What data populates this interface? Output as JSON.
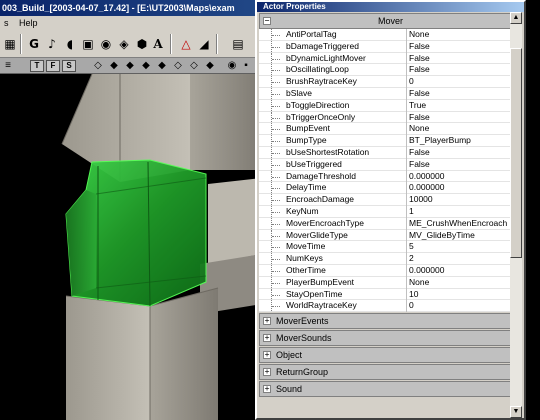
{
  "window": {
    "title": "003_Build_[2003-04-07_17.42] - [E:\\UT2003\\Maps\\exam",
    "menu": [
      "s",
      "Help"
    ]
  },
  "toolbar": {
    "icons": [
      "grid-icon",
      "g-icon",
      "music-note-icon",
      "speaker-icon",
      "mesh-icon",
      "eye-icon",
      "static-mesh-icon",
      "prefab-icon",
      "text-a-icon",
      "actor-triangle-icon",
      "terrain-icon",
      "level-icon"
    ],
    "glyph_g": "G",
    "glyph_a": "A"
  },
  "viewport_toolbar": {
    "buttons": [
      "T",
      "F",
      "S"
    ]
  },
  "properties": {
    "title": "Actor Properties",
    "open_group": "Mover",
    "rows": [
      {
        "name": "AntiPortalTag",
        "value": "None"
      },
      {
        "name": "bDamageTriggered",
        "value": "False"
      },
      {
        "name": "bDynamicLightMover",
        "value": "False"
      },
      {
        "name": "bOscillatingLoop",
        "value": "False"
      },
      {
        "name": "BrushRaytraceKey",
        "value": "0"
      },
      {
        "name": "bSlave",
        "value": "False"
      },
      {
        "name": "bToggleDirection",
        "value": "True"
      },
      {
        "name": "bTriggerOnceOnly",
        "value": "False"
      },
      {
        "name": "BumpEvent",
        "value": "None"
      },
      {
        "name": "BumpType",
        "value": "BT_PlayerBump"
      },
      {
        "name": "bUseShortestRotation",
        "value": "False"
      },
      {
        "name": "bUseTriggered",
        "value": "False"
      },
      {
        "name": "DamageThreshold",
        "value": "0.000000"
      },
      {
        "name": "DelayTime",
        "value": "0.000000"
      },
      {
        "name": "EncroachDamage",
        "value": "10000"
      },
      {
        "name": "KeyNum",
        "value": "1"
      },
      {
        "name": "MoverEncroachType",
        "value": "ME_CrushWhenEncroach"
      },
      {
        "name": "MoverGlideType",
        "value": "MV_GlideByTime"
      },
      {
        "name": "MoveTime",
        "value": "5"
      },
      {
        "name": "NumKeys",
        "value": "2"
      },
      {
        "name": "OtherTime",
        "value": "0.000000"
      },
      {
        "name": "PlayerBumpEvent",
        "value": "None"
      },
      {
        "name": "StayOpenTime",
        "value": "10"
      },
      {
        "name": "WorldRaytraceKey",
        "value": "0"
      }
    ],
    "collapsed_groups": [
      "MoverEvents",
      "MoverSounds",
      "Object",
      "ReturnGroup",
      "Sound"
    ],
    "expand_glyph": "+",
    "collapse_glyph": "−"
  },
  "colors": {
    "mover_green": "#2fbf3a",
    "pillar_grey": "#b8b4ac",
    "title_blue": "#0a246a"
  }
}
